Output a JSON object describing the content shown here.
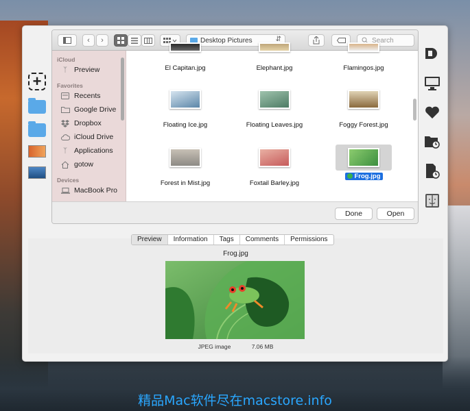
{
  "toolbar": {
    "path": "Desktop Pictures",
    "search_placeholder": "Search"
  },
  "sidebar": {
    "sections": [
      {
        "title": "iCloud",
        "items": [
          {
            "label": "Preview",
            "icon": "app-icon"
          }
        ]
      },
      {
        "title": "Favorites",
        "items": [
          {
            "label": "Recents",
            "icon": "recents-icon"
          },
          {
            "label": "Google Drive",
            "icon": "folder-icon"
          },
          {
            "label": "Dropbox",
            "icon": "dropbox-icon"
          },
          {
            "label": "iCloud Drive",
            "icon": "cloud-icon"
          },
          {
            "label": "Applications",
            "icon": "applications-icon"
          },
          {
            "label": "gotow",
            "icon": "home-icon"
          }
        ]
      },
      {
        "title": "Devices",
        "items": [
          {
            "label": "MacBook Pro",
            "icon": "laptop-icon"
          }
        ]
      }
    ]
  },
  "files": [
    {
      "name": "El Capitan.jpg",
      "colors": [
        "#2b2b2b",
        "#6a6a6a"
      ]
    },
    {
      "name": "Elephant.jpg",
      "colors": [
        "#bfa67a",
        "#e5d3a8"
      ]
    },
    {
      "name": "Flamingos.jpg",
      "colors": [
        "#d9b48a",
        "#eee"
      ]
    },
    {
      "name": "Floating Ice.jpg",
      "colors": [
        "#d6e4ef",
        "#5b86a8"
      ]
    },
    {
      "name": "Floating Leaves.jpg",
      "colors": [
        "#9fc3ad",
        "#4d7b64"
      ]
    },
    {
      "name": "Foggy Forest.jpg",
      "colors": [
        "#8a6a3e",
        "#e0d3b5"
      ]
    },
    {
      "name": "Forest in Mist.jpg",
      "colors": [
        "#8d8a85",
        "#c7c0b5"
      ]
    },
    {
      "name": "Foxtail Barley.jpg",
      "colors": [
        "#c65b5b",
        "#e9b0a3"
      ]
    },
    {
      "name": "Frog.jpg",
      "colors": [
        "#3c8f3f",
        "#8ccc6f"
      ],
      "selected": true
    }
  ],
  "buttons": {
    "done": "Done",
    "open": "Open"
  },
  "info": {
    "tabs": [
      "Preview",
      "Information",
      "Tags",
      "Comments",
      "Permissions"
    ],
    "active_tab": "Preview",
    "filename": "Frog.jpg",
    "kind": "JPEG image",
    "size": "7.06 MB"
  },
  "watermark": "精品Mac软件尽在macstore.info"
}
